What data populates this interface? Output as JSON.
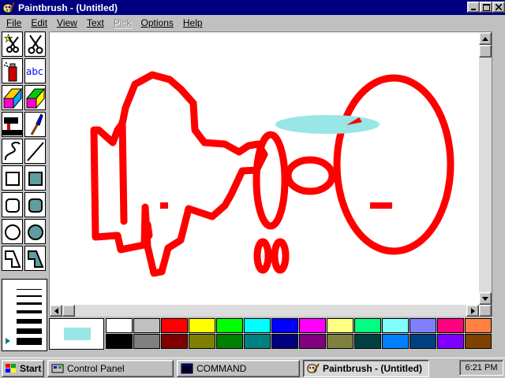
{
  "window": {
    "title": "Paintbrush - (Untitled)"
  },
  "menu": [
    {
      "label": "File",
      "disabled": false
    },
    {
      "label": "Edit",
      "disabled": false
    },
    {
      "label": "View",
      "disabled": false
    },
    {
      "label": "Text",
      "disabled": false
    },
    {
      "label": "Pick",
      "disabled": true
    },
    {
      "label": "Options",
      "disabled": false
    },
    {
      "label": "Help",
      "disabled": false
    }
  ],
  "tools": [
    "scissors-star-icon",
    "scissors-icon",
    "spray-can-icon",
    "text-tool-icon",
    "color-eraser-icon",
    "eraser-icon",
    "paint-roller-icon",
    "brush-icon",
    "curve-icon",
    "line-icon",
    "box-icon",
    "filled-box-icon",
    "rounded-box-icon",
    "filled-rounded-box-icon",
    "circle-icon",
    "filled-circle-icon",
    "polygon-icon",
    "filled-polygon-icon"
  ],
  "text_tool_label": "abc",
  "colors": {
    "foreground": "#ff0000",
    "background": "#ffffff",
    "selected_swatch": "#99e6e6",
    "titlebar": "#000080"
  },
  "palette": [
    [
      "#ffffff",
      "#c0c0c0",
      "#ff0000",
      "#ffff00",
      "#00ff00",
      "#00ffff",
      "#0000ff",
      "#ff00ff",
      "#ffff80",
      "#00ff80",
      "#80ffff",
      "#8080ff",
      "#ff0080",
      "#ff8040"
    ],
    [
      "#000000",
      "#808080",
      "#800000",
      "#808000",
      "#008000",
      "#008080",
      "#000080",
      "#800080",
      "#808040",
      "#004040",
      "#0080ff",
      "#004080",
      "#8000ff",
      "#804000"
    ]
  ],
  "taskbar": {
    "start": "Start",
    "tasks": [
      {
        "label": "Control Panel",
        "icon": "control-panel-icon",
        "active": false
      },
      {
        "label": "COMMAND",
        "icon": "command-prompt-icon",
        "active": false
      },
      {
        "label": "Paintbrush - (Untitled)",
        "icon": "paintbrush-icon",
        "active": true
      }
    ],
    "clock": "6:21 PM"
  }
}
